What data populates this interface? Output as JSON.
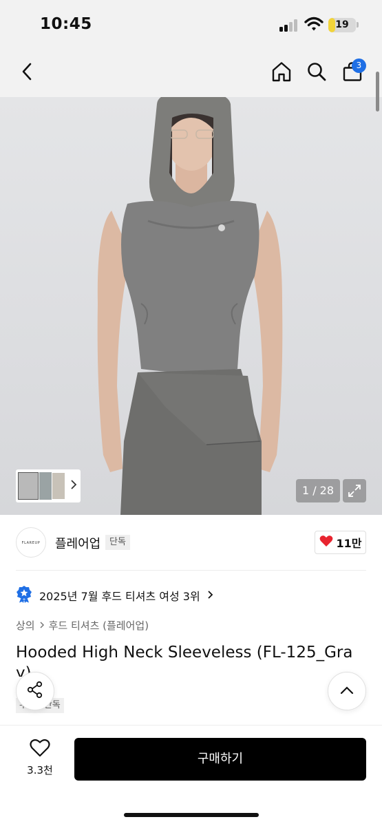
{
  "status_bar": {
    "time": "10:45",
    "battery_level": "19",
    "icons": [
      "signal-icon",
      "wifi-icon",
      "battery-icon"
    ]
  },
  "nav": {
    "icons": [
      "back-icon",
      "home-icon",
      "search-icon",
      "cart-icon"
    ],
    "cart_badge": "3"
  },
  "gallery": {
    "counter": "1 / 28",
    "icons": [
      "thumbnail-strip",
      "chevron-right-icon",
      "expand-icon"
    ]
  },
  "brand": {
    "logo_text": "FLAREUP",
    "name": "플레어업",
    "tag": "단독",
    "like_count": "11만"
  },
  "ranking": {
    "text": "2025년 7월 후드 티셔츠 여성 3위"
  },
  "category": {
    "level1": "상의",
    "level2": "후드 티셔츠 (플레어업)"
  },
  "product": {
    "title_line1": "Hooded High Neck Sleeveless (FL-125_Gra",
    "title_line2": "y)",
    "tag": "무신사단독"
  },
  "bottom_bar": {
    "wish_count": "3.3천",
    "buy_label": "구매하기"
  },
  "colors": {
    "accent_blue": "#1f6fe5",
    "heart_red": "#e8242f",
    "battery_yellow": "#f2d43a",
    "buy_button": "#000000"
  }
}
